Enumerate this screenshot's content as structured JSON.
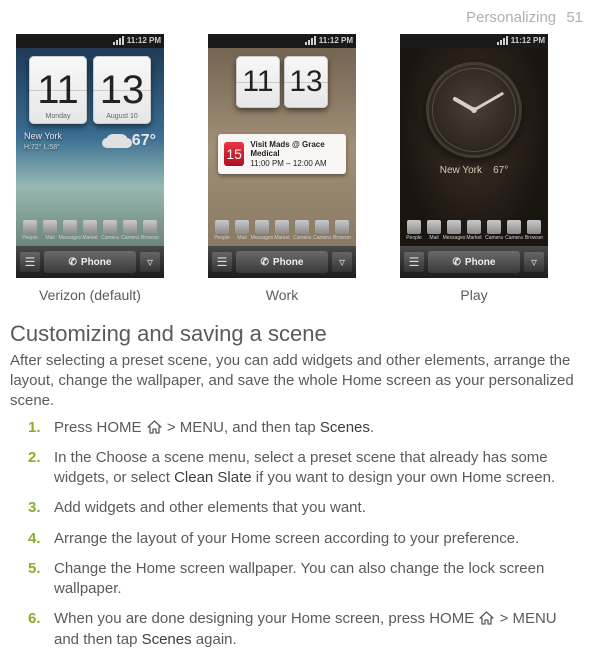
{
  "header": {
    "chapter": "Personalizing",
    "page_num": "51"
  },
  "screens": {
    "statusbar_time": "11:12 PM",
    "dock_phone": "Phone",
    "dock_icons": [
      "People",
      "Mail",
      "Messages",
      "Market",
      "Camera",
      "Camera",
      "Browser"
    ],
    "verizon": {
      "caption": "Verizon (default)",
      "clock_h": "11",
      "clock_m": "13",
      "sub_left": "Monday",
      "sub_right": "August 10",
      "city": "New York",
      "temp": "67°",
      "hl": "H:72° L:58°"
    },
    "work": {
      "caption": "Work",
      "clock_h": "11",
      "clock_m": "13",
      "mail_title": "Visit Mads @ Grace Medical",
      "mail_time": "11:00 PM – 12:00 AM"
    },
    "play": {
      "caption": "Play",
      "city": "New York",
      "temp": "67°"
    }
  },
  "section_heading": "Customizing and saving a scene",
  "intro": "After selecting a preset scene, you can add widgets and other elements, arrange the layout, change the wallpaper, and save the whole Home screen as your personalized scene.",
  "steps": [
    {
      "pre": "Press HOME ",
      "icon": true,
      "mid": " > MENU, and then tap ",
      "bold": "Scenes",
      "post": "."
    },
    {
      "pre": "In the Choose a scene menu, select a preset scene that already has some widgets, or select ",
      "bold": "Clean Slate",
      "post": " if you want to design your own Home screen."
    },
    {
      "pre": "Add widgets and other elements that you want."
    },
    {
      "pre": "Arrange the layout of your Home screen according to your preference."
    },
    {
      "pre": "Change the Home screen wallpaper. You can also change the lock screen wallpaper."
    },
    {
      "pre": "When you are done designing your Home screen, press HOME ",
      "icon": true,
      "mid": " > MENU and then tap ",
      "bold": "Scenes",
      "post": " again."
    }
  ]
}
